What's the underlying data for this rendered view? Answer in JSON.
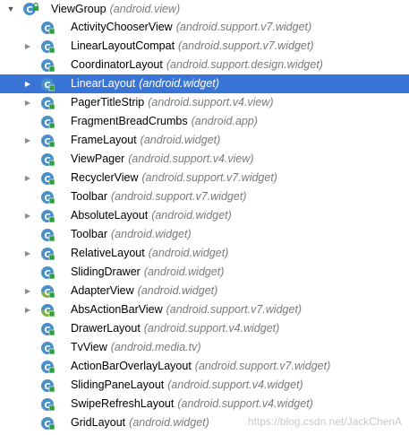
{
  "tree": {
    "root": {
      "name": "ViewGroup",
      "package": "(android.view)"
    },
    "items": [
      {
        "name": "ActivityChooserView",
        "package": "(android.support.v7.widget)",
        "expandable": false,
        "icon": "class-abstract-icon"
      },
      {
        "name": "LinearLayoutCompat",
        "package": "(android.support.v7.widget)",
        "expandable": true,
        "icon": "class-icon"
      },
      {
        "name": "CoordinatorLayout",
        "package": "(android.support.design.widget)",
        "expandable": false,
        "icon": "class-icon"
      },
      {
        "name": "LinearLayout",
        "package": "(android.widget)",
        "expandable": true,
        "icon": "class-icon",
        "selected": true
      },
      {
        "name": "PagerTitleStrip",
        "package": "(android.support.v4.view)",
        "expandable": true,
        "icon": "class-icon"
      },
      {
        "name": "FragmentBreadCrumbs",
        "package": "(android.app)",
        "expandable": false,
        "icon": "class-icon"
      },
      {
        "name": "FrameLayout",
        "package": "(android.widget)",
        "expandable": true,
        "icon": "class-icon"
      },
      {
        "name": "ViewPager",
        "package": "(android.support.v4.view)",
        "expandable": false,
        "icon": "class-icon"
      },
      {
        "name": "RecyclerView",
        "package": "(android.support.v7.widget)",
        "expandable": true,
        "icon": "class-icon"
      },
      {
        "name": "Toolbar",
        "package": "(android.support.v7.widget)",
        "expandable": false,
        "icon": "class-icon"
      },
      {
        "name": "AbsoluteLayout",
        "package": "(android.widget)",
        "expandable": true,
        "icon": "class-icon"
      },
      {
        "name": "Toolbar",
        "package": "(android.widget)",
        "expandable": false,
        "icon": "class-icon"
      },
      {
        "name": "RelativeLayout",
        "package": "(android.widget)",
        "expandable": true,
        "icon": "class-icon"
      },
      {
        "name": "SlidingDrawer",
        "package": "(android.widget)",
        "expandable": false,
        "icon": "class-icon"
      },
      {
        "name": "AdapterView",
        "package": "(android.widget)",
        "expandable": true,
        "icon": "abstract-class-icon"
      },
      {
        "name": "AbsActionBarView",
        "package": "(android.support.v7.widget)",
        "expandable": true,
        "icon": "abstract-class-icon"
      },
      {
        "name": "DrawerLayout",
        "package": "(android.support.v4.widget)",
        "expandable": false,
        "icon": "class-icon"
      },
      {
        "name": "TvView",
        "package": "(android.media.tv)",
        "expandable": false,
        "icon": "class-icon"
      },
      {
        "name": "ActionBarOverlayLayout",
        "package": "(android.support.v7.widget)",
        "expandable": false,
        "icon": "class-icon"
      },
      {
        "name": "SlidingPaneLayout",
        "package": "(android.support.v4.widget)",
        "expandable": false,
        "icon": "class-icon"
      },
      {
        "name": "SwipeRefreshLayout",
        "package": "(android.support.v4.widget)",
        "expandable": false,
        "icon": "class-icon"
      },
      {
        "name": "GridLayout",
        "package": "(android.widget)",
        "expandable": false,
        "icon": "class-icon"
      }
    ]
  },
  "colors": {
    "selection": "#3875d7",
    "class_icon": "#4a90c8",
    "abstract_icon": "#7cb342",
    "lock": "#2e9e3e"
  },
  "watermark": "https://blog.csdn.net/JackChenA"
}
